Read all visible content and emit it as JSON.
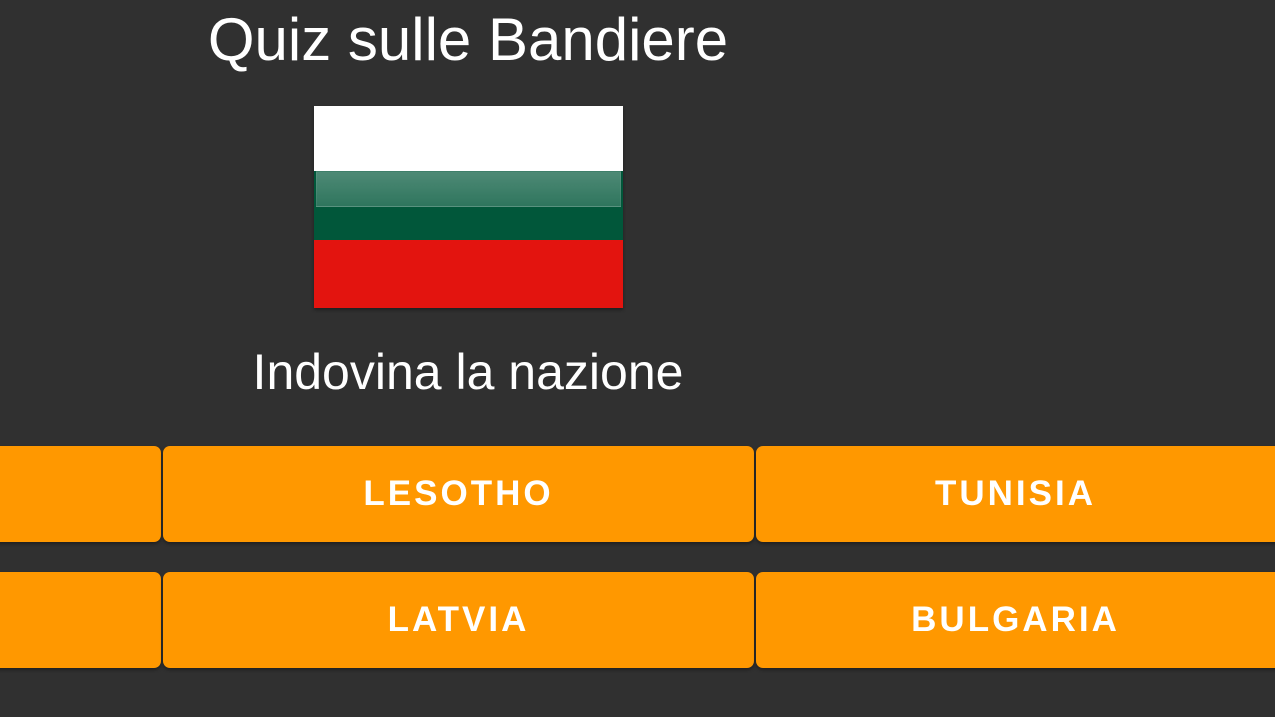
{
  "quiz": {
    "title": "Quiz sulle Bandiere",
    "prompt": "Indovina la nazione",
    "flag": {
      "name": "flag-image",
      "stripes": [
        "#ffffff",
        "#01573a",
        "#e3140f"
      ]
    },
    "answers": [
      {
        "label": "LESOTHO"
      },
      {
        "label": "TUNISIA"
      },
      {
        "label": "LATVIA"
      },
      {
        "label": "BULGARIA"
      }
    ]
  },
  "colors": {
    "background": "#303030",
    "button": "#ff9800",
    "text": "#ffffff"
  }
}
